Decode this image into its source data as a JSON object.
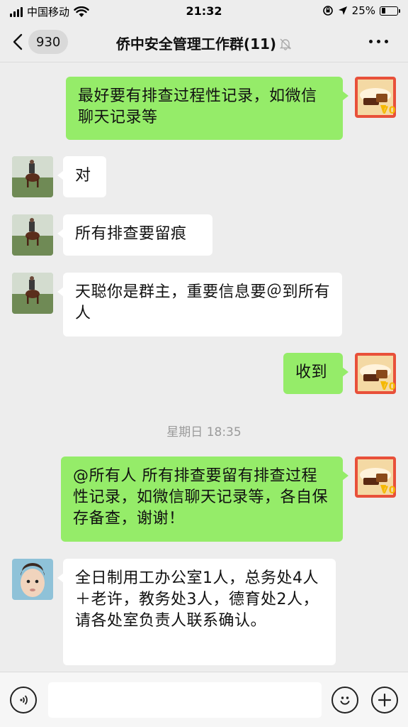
{
  "status_bar": {
    "carrier": "中国移动",
    "time": "21:32",
    "battery": "25%",
    "battery_level": 0.25
  },
  "nav": {
    "back_count": "930",
    "title": "侨中安全管理工作群(11)",
    "icons": [
      "back-chevron-icon",
      "mute-bell-icon",
      "more-icon"
    ]
  },
  "messages": [
    {
      "side": "out",
      "text": "最好要有排查过程性记录，如微信聊天记录等"
    },
    {
      "side": "in",
      "text": "对"
    },
    {
      "side": "in",
      "text": "所有排查要留痕"
    },
    {
      "side": "in",
      "text": "天聪你是群主，重要信息要＠到所有人"
    },
    {
      "side": "out",
      "text": "收到"
    },
    {
      "side": "out",
      "text": "@所有人 所有排查要留有排查过程性记录，如微信聊天记录等，各自保存备查，谢谢！"
    },
    {
      "side": "in",
      "text": "全日制用工办公室1人，总务处4人＋老许，教务处3人，德育处2人，请各处室负责人联系确认。"
    }
  ],
  "time_separator": "星期日 18:35",
  "input_bar": {
    "icons": [
      "voice-icon",
      "emoji-icon",
      "plus-icon"
    ],
    "placeholder": ""
  },
  "colors": {
    "background": "#ededed",
    "outgoing_bubble": "#95ec69",
    "incoming_bubble": "#ffffff"
  }
}
